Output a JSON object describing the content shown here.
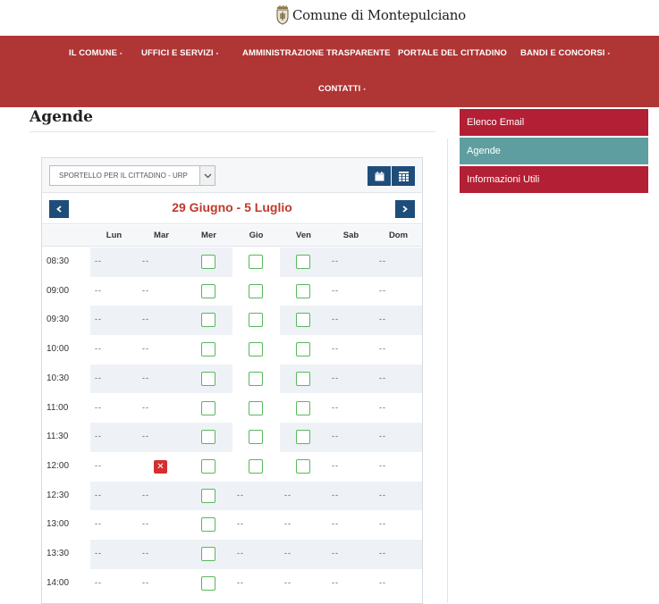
{
  "site": {
    "title": "Comune di Montepulciano"
  },
  "nav": {
    "items": [
      {
        "label": "IL COMUNE",
        "caret": "▪"
      },
      {
        "label": "UFFICI E SERVIZI",
        "caret": "▪"
      },
      {
        "label": "AMMINISTRAZIONE TRASPARENTE",
        "caret": ""
      },
      {
        "label": "PORTALE DEL CITTADINO",
        "caret": ""
      },
      {
        "label": "BANDI E CONCORSI",
        "caret": "▪"
      },
      {
        "label": "CONTATTI",
        "caret": "▪"
      }
    ]
  },
  "page": {
    "title": "Agende"
  },
  "sidebar": {
    "items": [
      {
        "label": "Elenco Email",
        "color": "#b31f34"
      },
      {
        "label": "Agende",
        "color": "#5f9ea0"
      },
      {
        "label": "Informazioni Utili",
        "color": "#b31f34"
      }
    ]
  },
  "calendar": {
    "select_value": "SPORTELLO PER IL CITTADINO - URP",
    "range_label": "29 Giugno - 5 Luglio",
    "days": [
      "Lun",
      "Mar",
      "Mer",
      "Gio",
      "Ven",
      "Sab",
      "Dom"
    ],
    "empty_mark": "--",
    "unavailable_mark": "✕",
    "slots": [
      {
        "time": "08:30",
        "cells": [
          "dash",
          "dash",
          "free",
          "free",
          "free",
          "dash",
          "dash"
        ]
      },
      {
        "time": "09:00",
        "cells": [
          "dash",
          "dash",
          "free",
          "free",
          "free",
          "dash",
          "dash"
        ]
      },
      {
        "time": "09:30",
        "cells": [
          "dash",
          "dash",
          "free",
          "free",
          "free",
          "dash",
          "dash"
        ]
      },
      {
        "time": "10:00",
        "cells": [
          "dash",
          "dash",
          "free",
          "free",
          "free",
          "dash",
          "dash"
        ]
      },
      {
        "time": "10:30",
        "cells": [
          "dash",
          "dash",
          "free",
          "free",
          "free",
          "dash",
          "dash"
        ]
      },
      {
        "time": "11:00",
        "cells": [
          "dash",
          "dash",
          "free",
          "free",
          "free",
          "dash",
          "dash"
        ]
      },
      {
        "time": "11:30",
        "cells": [
          "dash",
          "dash",
          "free",
          "free",
          "free",
          "dash",
          "dash"
        ]
      },
      {
        "time": "12:00",
        "cells": [
          "dash",
          "taken",
          "free",
          "free",
          "free",
          "dash",
          "dash"
        ]
      },
      {
        "time": "12:30",
        "cells": [
          "dash",
          "dash",
          "free",
          "dash",
          "dash",
          "dash",
          "dash"
        ]
      },
      {
        "time": "13:00",
        "cells": [
          "dash",
          "dash",
          "free",
          "dash",
          "dash",
          "dash",
          "dash"
        ]
      },
      {
        "time": "13:30",
        "cells": [
          "dash",
          "dash",
          "free",
          "dash",
          "dash",
          "dash",
          "dash"
        ]
      },
      {
        "time": "14:00",
        "cells": [
          "dash",
          "dash",
          "free",
          "dash",
          "dash",
          "dash",
          "dash"
        ]
      }
    ],
    "colors": {
      "free_border": "#58b85c",
      "taken": "#d32f2f",
      "header_text": "#c0392b",
      "button": "#1f4d7a",
      "shade": "#eef2f7"
    }
  }
}
